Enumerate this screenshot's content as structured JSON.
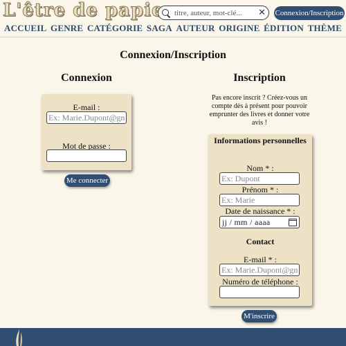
{
  "header": {
    "logo_text": "L'être de papier",
    "search": {
      "placeholder": "titre, auteur, mot-clé...",
      "value": ""
    },
    "login_button": "Connexion/Inscription"
  },
  "nav": [
    "ACCUEIL",
    "GENRE",
    "CATÉGORIE",
    "SAGA",
    "AUTEUR",
    "ORIGINE",
    "ÉDITION",
    "THÈME"
  ],
  "page": {
    "title": "Connexion/Inscription"
  },
  "login": {
    "title": "Connexion",
    "email_label": "E-mail :",
    "email_placeholder": "Ex: Marie.Dupont@gmail.com",
    "password_label": "Mot de passe :",
    "submit": "Me connecter"
  },
  "signup": {
    "title": "Inscription",
    "intro": "Pas encore inscrit ? Créez-vous un compte dès à présent pour pouvoir emprunter des livres et donner votre avis !",
    "personal_title": "Informations personnelles",
    "lastname_label": "Nom * :",
    "lastname_placeholder": "Ex: Dupont",
    "firstname_label": "Prénom * :",
    "firstname_placeholder": "Ex: Marie",
    "birthdate_label": "Date de naissance * :",
    "birthdate_placeholder": "jj / mm / aaaa",
    "contact_title": "Contact",
    "email_label": "E-mail * :",
    "email_placeholder": "Ex: Marie.Dupont@gmail.com",
    "phone_label": "Numéro de téléphone :",
    "submit": "M'inscrire"
  },
  "colors": {
    "accent": "#314d70",
    "card": "#eee2c6",
    "background": "#fbf6ea"
  }
}
